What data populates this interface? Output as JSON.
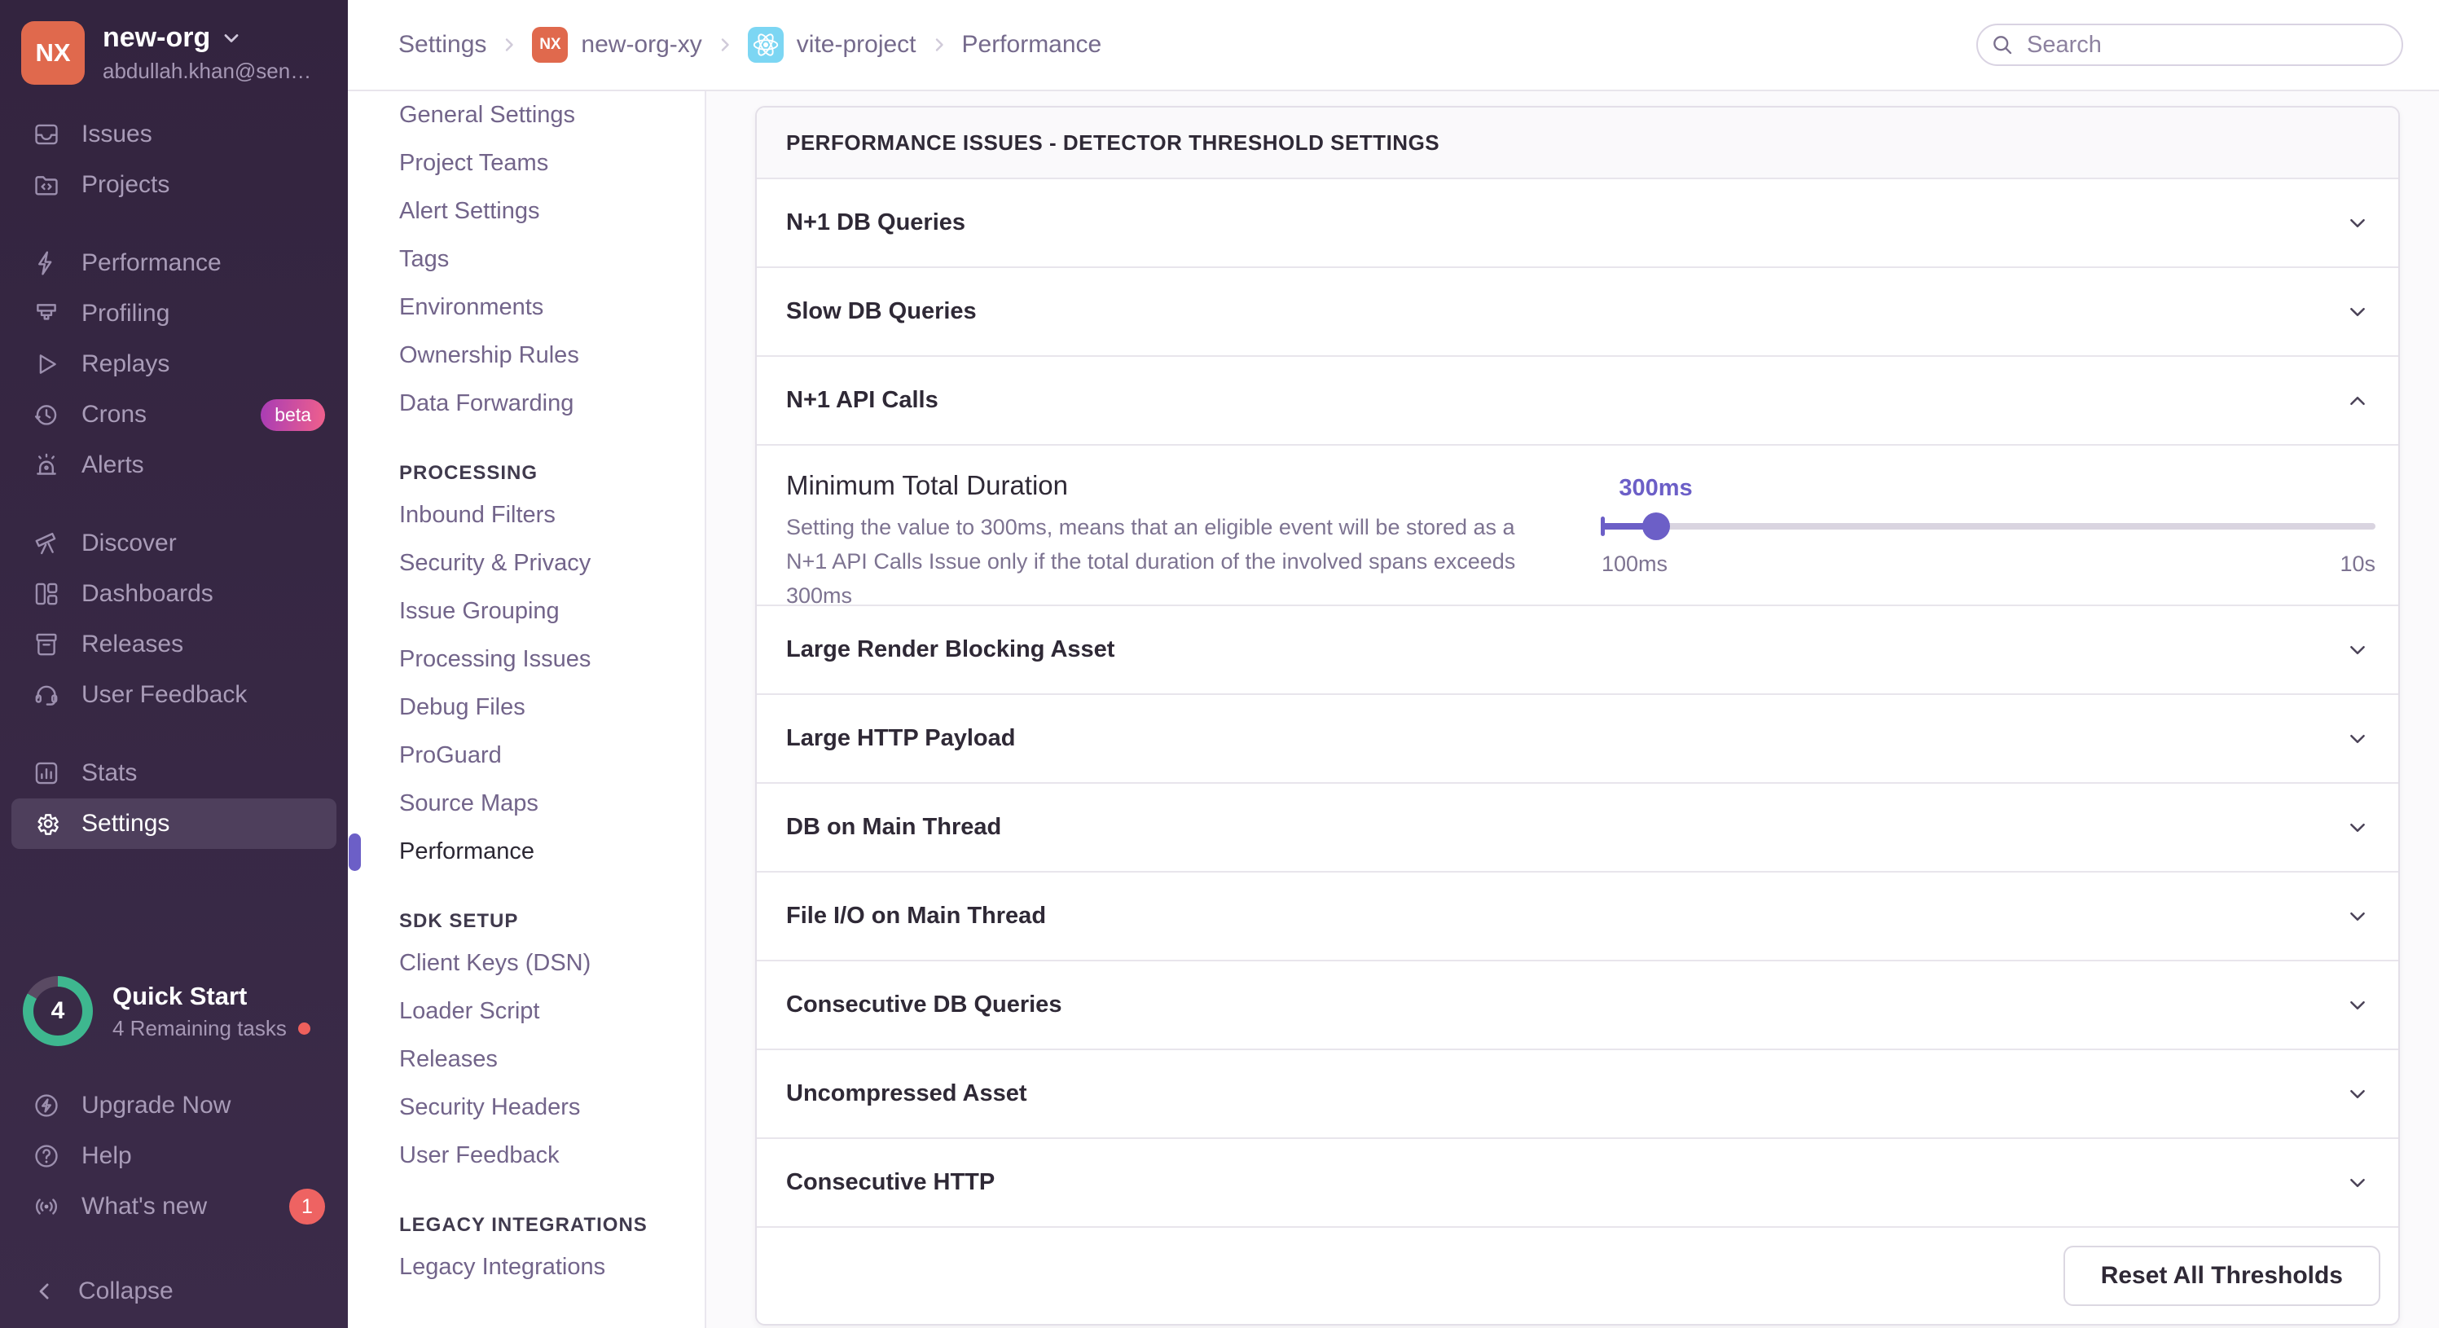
{
  "colors": {
    "accent_purple": "#6c5fc7",
    "org_avatar": "#e0694d",
    "react_badge": "#7cd6f3",
    "beta_badge_gradient": [
      "#a83cb5",
      "#f0608c"
    ],
    "alert_red": "#ee6362",
    "progress_teal": "#3eb78f"
  },
  "sidebar": {
    "org": {
      "initials": "NX",
      "name": "new-org",
      "email": "abdullah.khan@sen…"
    },
    "groups": [
      {
        "items": [
          {
            "label": "Issues",
            "icon": "issues-icon"
          },
          {
            "label": "Projects",
            "icon": "projects-icon"
          }
        ]
      },
      {
        "items": [
          {
            "label": "Performance",
            "icon": "performance-icon"
          },
          {
            "label": "Profiling",
            "icon": "profiling-icon"
          },
          {
            "label": "Replays",
            "icon": "replays-icon"
          },
          {
            "label": "Crons",
            "icon": "crons-icon",
            "badge": "beta"
          },
          {
            "label": "Alerts",
            "icon": "alerts-icon"
          }
        ]
      },
      {
        "items": [
          {
            "label": "Discover",
            "icon": "discover-icon"
          },
          {
            "label": "Dashboards",
            "icon": "dashboards-icon"
          },
          {
            "label": "Releases",
            "icon": "releases-icon"
          },
          {
            "label": "User Feedback",
            "icon": "feedback-icon"
          }
        ]
      },
      {
        "items": [
          {
            "label": "Stats",
            "icon": "stats-icon"
          },
          {
            "label": "Settings",
            "icon": "settings-icon",
            "active": true
          }
        ]
      }
    ],
    "quick_start": {
      "label": "Quick Start",
      "count": "4",
      "subtitle": "4 Remaining tasks"
    },
    "footer_items": [
      {
        "label": "Upgrade Now",
        "icon": "upgrade-icon"
      },
      {
        "label": "Help",
        "icon": "help-icon"
      },
      {
        "label": "What's new",
        "icon": "whatsnew-icon",
        "badge": "1"
      }
    ],
    "collapse_label": "Collapse"
  },
  "topbar": {
    "breadcrumbs": [
      {
        "label": "Settings"
      },
      {
        "label": "new-org-xy",
        "chip": "org",
        "chip_text": "NX"
      },
      {
        "label": "vite-project",
        "chip": "react"
      },
      {
        "label": "Performance"
      }
    ],
    "search_placeholder": "Search"
  },
  "settings_nav": {
    "sections": [
      {
        "header": "",
        "items": [
          {
            "label": "General Settings"
          },
          {
            "label": "Project Teams"
          },
          {
            "label": "Alert Settings"
          },
          {
            "label": "Tags"
          },
          {
            "label": "Environments"
          },
          {
            "label": "Ownership Rules"
          },
          {
            "label": "Data Forwarding"
          }
        ]
      },
      {
        "header": "PROCESSING",
        "items": [
          {
            "label": "Inbound Filters"
          },
          {
            "label": "Security & Privacy"
          },
          {
            "label": "Issue Grouping"
          },
          {
            "label": "Processing Issues"
          },
          {
            "label": "Debug Files"
          },
          {
            "label": "ProGuard"
          },
          {
            "label": "Source Maps"
          },
          {
            "label": "Performance",
            "active": true
          }
        ]
      },
      {
        "header": "SDK SETUP",
        "items": [
          {
            "label": "Client Keys (DSN)"
          },
          {
            "label": "Loader Script"
          },
          {
            "label": "Releases"
          },
          {
            "label": "Security Headers"
          },
          {
            "label": "User Feedback"
          }
        ]
      },
      {
        "header": "LEGACY INTEGRATIONS",
        "items": [
          {
            "label": "Legacy Integrations"
          }
        ]
      }
    ]
  },
  "panel": {
    "title": "PERFORMANCE ISSUES - DETECTOR THRESHOLD SETTINGS",
    "rows": [
      {
        "label": "N+1 DB Queries",
        "expanded": false
      },
      {
        "label": "Slow DB Queries",
        "expanded": false
      },
      {
        "label": "N+1 API Calls",
        "expanded": true
      },
      {
        "label": "Large Render Blocking Asset",
        "expanded": false
      },
      {
        "label": "Large HTTP Payload",
        "expanded": false
      },
      {
        "label": "DB on Main Thread",
        "expanded": false
      },
      {
        "label": "File I/O on Main Thread",
        "expanded": false
      },
      {
        "label": "Consecutive DB Queries",
        "expanded": false
      },
      {
        "label": "Uncompressed Asset",
        "expanded": false
      },
      {
        "label": "Consecutive HTTP",
        "expanded": false
      }
    ],
    "detail": {
      "title": "Minimum Total Duration",
      "description": "Setting the value to 300ms, means that an eligible event will be stored as a N+1 API Calls Issue only if the total duration of the involved spans exceeds 300ms",
      "slider": {
        "value_label": "300ms",
        "min_label": "100ms",
        "max_label": "10s",
        "percent": 7
      }
    },
    "footer_button": "Reset All Thresholds"
  }
}
